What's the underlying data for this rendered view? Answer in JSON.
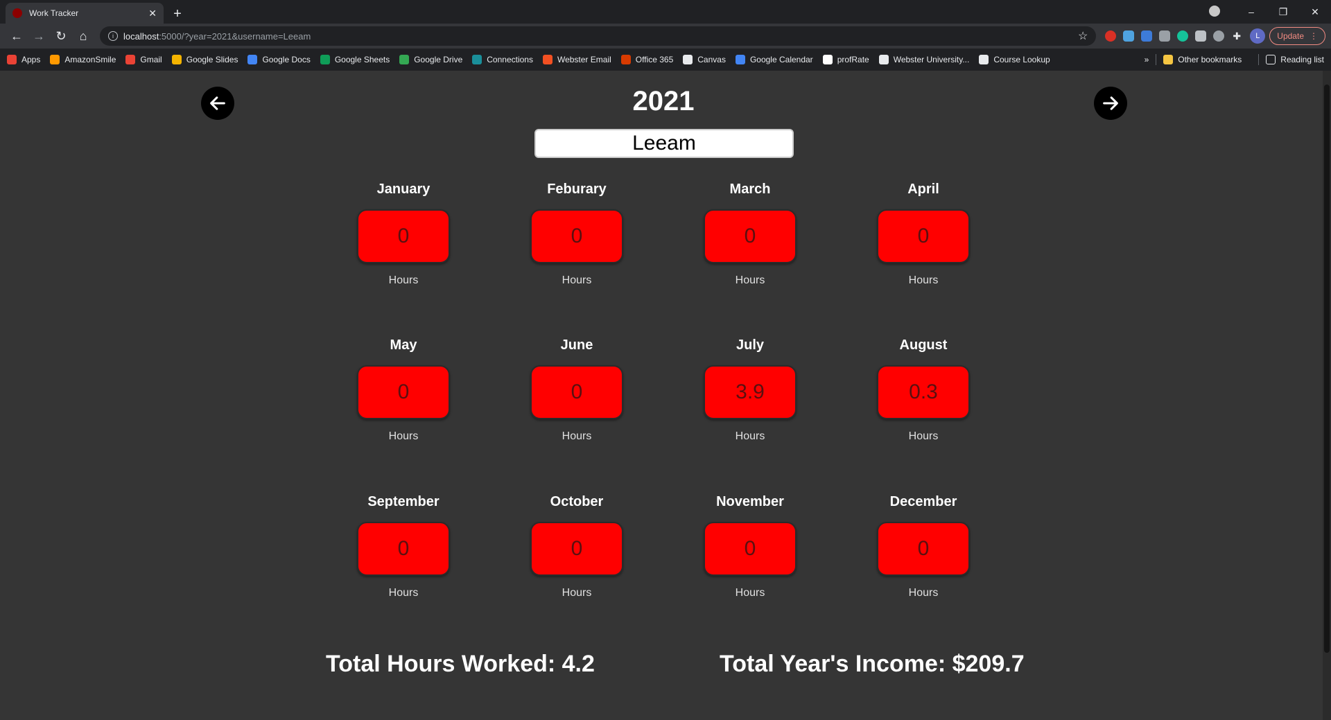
{
  "browser": {
    "tab_title": "Work Tracker",
    "url_host": "localhost",
    "url_path": ":5000/?year=2021&username=Leeam",
    "avatar_initial": "L",
    "update_label": "Update",
    "bookmarks": [
      {
        "label": "Apps",
        "color": "#e94235"
      },
      {
        "label": "AmazonSmile",
        "color": "#ff9900"
      },
      {
        "label": "Gmail",
        "color": "#ea4335"
      },
      {
        "label": "Google Slides",
        "color": "#f4b400"
      },
      {
        "label": "Google Docs",
        "color": "#4285f4"
      },
      {
        "label": "Google Sheets",
        "color": "#0f9d58"
      },
      {
        "label": "Google Drive",
        "color": "#34a853"
      },
      {
        "label": "Connections",
        "color": "#1a8f9a"
      },
      {
        "label": "Webster Email",
        "color": "#f25022"
      },
      {
        "label": "Office 365",
        "color": "#d83b01"
      },
      {
        "label": "Canvas",
        "color": "#e8eaed"
      },
      {
        "label": "Google Calendar",
        "color": "#4285f4"
      },
      {
        "label": "profRate",
        "color": "#ffffff"
      },
      {
        "label": "Webster University...",
        "color": "#e8eaed"
      },
      {
        "label": "Course Lookup",
        "color": "#e8eaed"
      }
    ],
    "chevron_label": "»",
    "other_bookmarks": "Other bookmarks",
    "reading_list": "Reading list"
  },
  "page": {
    "year": "2021",
    "username": "Leeam",
    "months": [
      {
        "name": "January",
        "value": "0",
        "unit": "Hours"
      },
      {
        "name": "Feburary",
        "value": "0",
        "unit": "Hours"
      },
      {
        "name": "March",
        "value": "0",
        "unit": "Hours"
      },
      {
        "name": "April",
        "value": "0",
        "unit": "Hours"
      },
      {
        "name": "May",
        "value": "0",
        "unit": "Hours"
      },
      {
        "name": "June",
        "value": "0",
        "unit": "Hours"
      },
      {
        "name": "July",
        "value": "3.9",
        "unit": "Hours"
      },
      {
        "name": "August",
        "value": "0.3",
        "unit": "Hours"
      },
      {
        "name": "September",
        "value": "0",
        "unit": "Hours"
      },
      {
        "name": "October",
        "value": "0",
        "unit": "Hours"
      },
      {
        "name": "November",
        "value": "0",
        "unit": "Hours"
      },
      {
        "name": "December",
        "value": "0",
        "unit": "Hours"
      }
    ],
    "total_hours": "Total Hours Worked: 4.2",
    "total_income": "Total Year's Income: $209.7",
    "accent_color": "#ff0000"
  }
}
